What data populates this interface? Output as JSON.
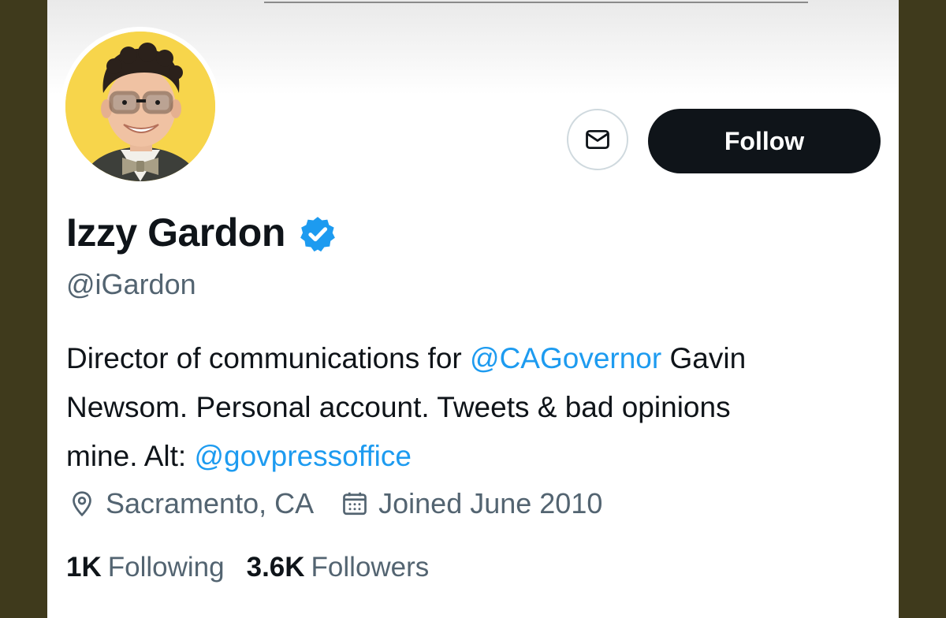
{
  "profile": {
    "name": "Izzy Gardon",
    "handle": "@iGardon",
    "verified": true,
    "avatar": "profile-photo-man-glasses-bowtie-yellow-background",
    "bio": {
      "line1_text": "Director of communications for ",
      "line1_mention": "@CAGovernor",
      "line1_tail": " Gavin",
      "line2": "Newsom. Personal account. Tweets & bad opinions",
      "line3_text": "mine. Alt: ",
      "line3_mention": "@govpressoffice"
    },
    "location": "Sacramento, CA",
    "joined": "Joined June 2010",
    "following_count": "1K",
    "following_label": "Following",
    "followers_count": "3.6K",
    "followers_label": "Followers"
  },
  "actions": {
    "message_icon": "envelope-icon",
    "follow_label": "Follow"
  },
  "colors": {
    "accent": "#1d9bf0",
    "button_dark": "#0f1419",
    "secondary_text": "#536471",
    "avatar_bg": "#f7d54b",
    "frame": "#3f3a1c"
  }
}
